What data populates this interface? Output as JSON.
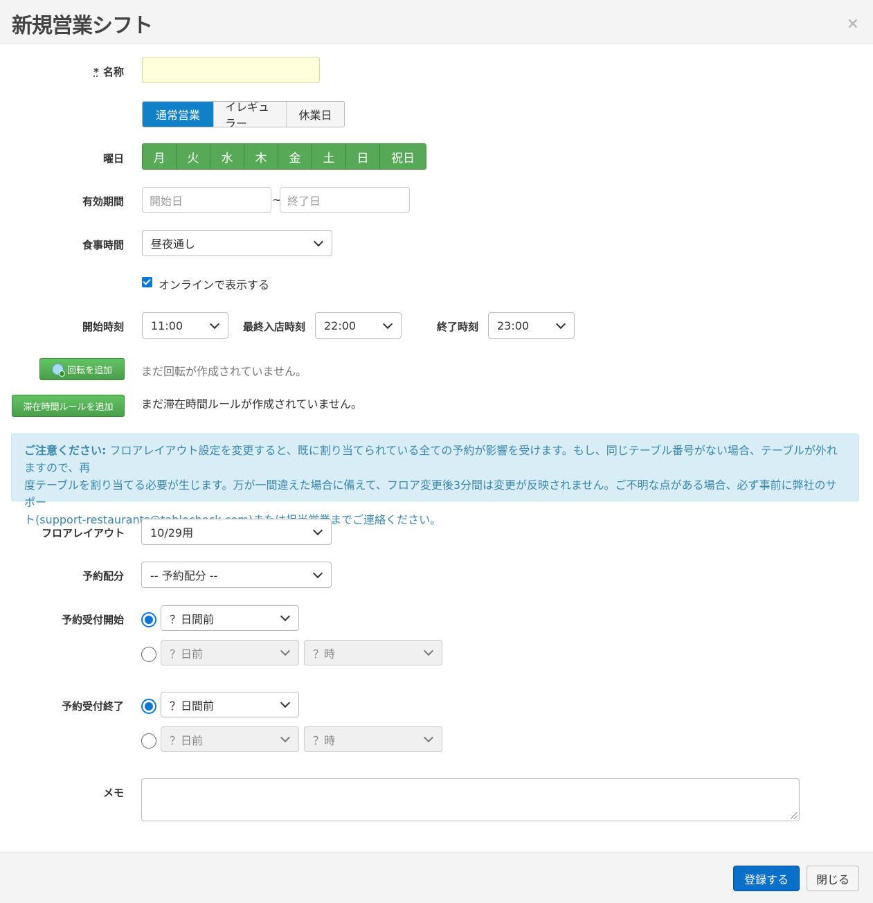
{
  "modal": {
    "title": "新規営業シフト",
    "close": "×"
  },
  "name_field": {
    "required_mark": "*",
    "label": "名称",
    "value": ""
  },
  "shift_type": {
    "options": [
      "通常営業",
      "イレギュラー",
      "休業日"
    ],
    "selected": "通常営業"
  },
  "weekdays": {
    "label": "曜日",
    "days": [
      "月",
      "火",
      "水",
      "木",
      "金",
      "土",
      "日",
      "祝日"
    ]
  },
  "validity": {
    "label": "有効期間",
    "start_placeholder": "開始日",
    "separator": "~",
    "end_placeholder": "終了日"
  },
  "meal_time": {
    "label": "食事時間",
    "value": "昼夜通し"
  },
  "online": {
    "checked": true,
    "label": "オンラインで表示する"
  },
  "times": {
    "start_label": "開始時刻",
    "start_value": "11:00",
    "last_entry_label": "最終入店時刻",
    "last_entry_value": "22:00",
    "end_label": "終了時刻",
    "end_value": "23:00"
  },
  "rotation": {
    "button": "回転を追加",
    "empty": "まだ回転が作成されていません。"
  },
  "stay_rule": {
    "button": "滞在時間ルールを追加",
    "empty": "まだ滞在時間ルールが作成されていません。"
  },
  "alert": {
    "title": "ご注意ください:",
    "line1": " フロアレイアウト設定を変更すると、既に割り当てられている全ての予約が影響を受けます。もし、同じテーブル番号がない場合、テーブルが外れますので、再",
    "line2": "度テーブルを割り当てる必要が生じます。万が一間違えた場合に備えて、フロア変更後3分間は変更が反映されません。ご不明な点がある場合、必ず事前に弊社のサポー",
    "line3": "ト(support-restaurants@tablecheck.com)または担当営業までご連絡ください。"
  },
  "floor_layout": {
    "label": "フロアレイアウト",
    "value": "10/29用"
  },
  "allocation": {
    "label": "予約配分",
    "value": "-- 予約配分 --"
  },
  "booking_start": {
    "label": "予約受付開始",
    "option1_value": "？日間前",
    "option2_day": "？日前",
    "option2_hour": "？時",
    "selected": 1
  },
  "booking_end": {
    "label": "予約受付終了",
    "option1_value": "？日間前",
    "option2_day": "？日前",
    "option2_hour": "？時",
    "selected": 1
  },
  "memo": {
    "label": "メモ",
    "value": ""
  },
  "footer": {
    "submit": "登録する",
    "close": "閉じる"
  },
  "colors": {
    "primary": "#0a6fc8",
    "day_green": "#57a957",
    "active_tab": "#1080c8",
    "alert_bg": "#d9edf7",
    "alert_text": "#3a87ad",
    "name_input_bg": "#ffffdc"
  }
}
